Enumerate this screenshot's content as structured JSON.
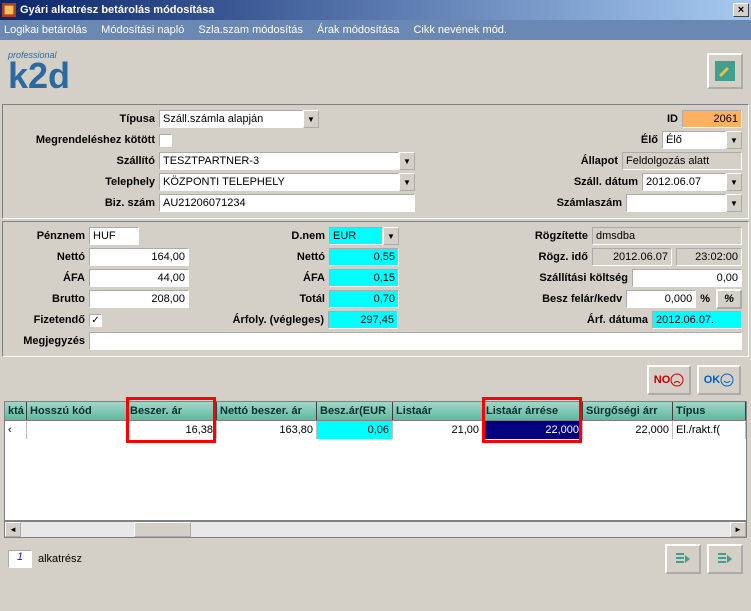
{
  "title": "Gyári alkatrész betárolás módosítása",
  "menu": [
    "Logikai betárolás",
    "Módosítási napló",
    "Szla.szam módosítás",
    "Árak módosítása",
    "Cikk nevének mód."
  ],
  "logo_small": "professional",
  "logo_big": "k2d",
  "form": {
    "tipusa_label": "Típusa",
    "tipusa_value": "Száll.számla alapján",
    "id_label": "ID",
    "id_value": "2061",
    "megrend_label": "Megrendeléshez kötött",
    "megrend_checked": false,
    "elo_label": "Élő",
    "elo_value": "Élő",
    "szallito_label": "Szállító",
    "szallito_value": "TESZTPARTNER-3",
    "allapot_label": "Állapot",
    "allapot_value": "Feldolgozás alatt",
    "telephely_label": "Telephely",
    "telephely_value": "KÖZPONTI TELEPHELY",
    "szalldatum_label": "Száll. dátum",
    "szalldatum_value": "2012.06.07",
    "bizszam_label": "Biz. szám",
    "bizszam_value": "AU21206071234",
    "szamlaszam_label": "Számlaszám",
    "szamlaszam_value": "",
    "penznem_label": "Pénznem",
    "penznem_value": "HUF",
    "dnem_label": "D.nem",
    "dnem_value": "EUR",
    "rogzitette_label": "Rögzítette",
    "rogzitette_value": "dmsdba",
    "netto_label": "Nettó",
    "netto_value": "164,00",
    "netto2_label": "Nettó",
    "netto2_value": "0,55",
    "rogzido_label": "Rögz. idő",
    "rogzido_date": "2012.06.07",
    "rogzido_time": "23:02:00",
    "afa_label": "ÁFA",
    "afa_value": "44,00",
    "afa2_label": "ÁFA",
    "afa2_value": "0,15",
    "szallktg_label": "Szállítási költség",
    "szallktg_value": "0,00",
    "brutto_label": "Brutto",
    "brutto_value": "208,00",
    "total_label": "Totál",
    "total_value": "0,70",
    "beszfelar_label": "Besz felár/kedv",
    "beszfelar_value": "0,000",
    "percent": "%",
    "percentbtn": "%",
    "fizetendo_label": "Fizetendő",
    "fizetendo_checked": true,
    "arfoly_label": "Árfoly. (végleges)",
    "arfoly_value": "297,45",
    "arfdatum_label": "Árf. dátuma",
    "arfdatum_value": "2012.06.07.",
    "megjegy_label": "Megjegyzés",
    "megjegy_value": ""
  },
  "btns": {
    "no": "NO",
    "ok": "OK"
  },
  "grid": {
    "headers": [
      "ktá",
      "Hosszú kód",
      "Beszer. ár",
      "Nettó beszer. ár",
      "Besz.ár(EUR",
      "Listaár",
      "Listaár árrése",
      "Sürgőségi árr",
      "Típus"
    ],
    "row": {
      "c0": "‹",
      "c1": "",
      "c2": "16,38",
      "c3": "163,80",
      "c4": "0,06",
      "c5": "21,00",
      "c6": "22,000",
      "c7": "22,000",
      "c8": "El./rakt.f("
    }
  },
  "footer": {
    "page": "1",
    "label": "alkatrész"
  }
}
